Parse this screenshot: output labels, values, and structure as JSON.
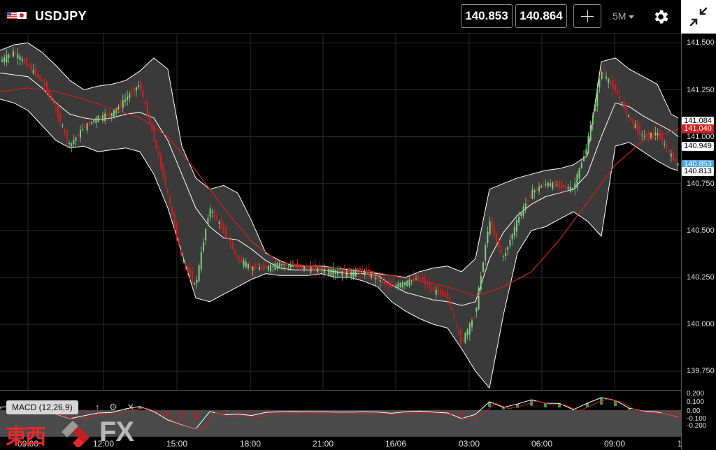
{
  "header": {
    "symbol": "USDJPY",
    "bid": "140.853",
    "ask": "140.864",
    "interval": "5M",
    "icons": [
      "us-flag-icon",
      "japan-flag-icon",
      "crosshair-icon",
      "gear-icon",
      "collapse-icon"
    ]
  },
  "y_axis": {
    "labels": [
      "141.500",
      "141.250",
      "141.000",
      "140.750",
      "140.500",
      "140.250",
      "140.000",
      "139.750"
    ],
    "tags": [
      {
        "text": "141.084",
        "style": "w"
      },
      {
        "text": "141.040",
        "style": "r"
      },
      {
        "text": "140.949",
        "style": "w"
      },
      {
        "text": "140.853",
        "style": "b"
      },
      {
        "text": "140.813",
        "style": "w"
      }
    ]
  },
  "macd": {
    "label": "MACD (12,26,9)",
    "axis_labels": [
      "0.200",
      "0.100",
      "0.00",
      "-0.100",
      "-0.200"
    ],
    "tools": [
      "↑",
      "⚙",
      "✕"
    ]
  },
  "x_axis": {
    "labels": [
      "09:00",
      "12:00",
      "15:00",
      "18:00",
      "21:00",
      "16/06",
      "03:00",
      "06:00",
      "09:00",
      "1"
    ]
  },
  "logo": {
    "kanji": "東西",
    "fx": "FX"
  },
  "colors": {
    "background": "#000000",
    "band_fill": "#3a3a3a",
    "band_line": "#ffffff",
    "ma_line": "#d0211f",
    "bull": "#7fd07f",
    "bear": "#d0211f"
  },
  "chart_data": {
    "type": "line",
    "title": "",
    "ylim": [
      139.65,
      141.55
    ],
    "bollinger": {
      "x": [
        0,
        20,
        40,
        60,
        80,
        100,
        120,
        140,
        160,
        180,
        200,
        220,
        240,
        260,
        280,
        300,
        320,
        340,
        360,
        380,
        400,
        420,
        440,
        460,
        480,
        500,
        520,
        540,
        560,
        580,
        600,
        620,
        640,
        660,
        680,
        700,
        720,
        740,
        760,
        780,
        800,
        820,
        840,
        860,
        880,
        900,
        920,
        940,
        960,
        970
      ],
      "upper": [
        141.46,
        141.49,
        141.5,
        141.45,
        141.38,
        141.3,
        141.25,
        141.27,
        141.28,
        141.3,
        141.35,
        141.42,
        141.36,
        140.95,
        140.78,
        140.72,
        140.74,
        140.7,
        140.55,
        140.38,
        140.34,
        140.31,
        140.31,
        140.31,
        140.3,
        140.29,
        140.28,
        140.27,
        140.26,
        140.25,
        140.28,
        140.3,
        140.31,
        140.28,
        140.35,
        140.72,
        140.75,
        140.78,
        140.8,
        140.82,
        140.83,
        140.85,
        140.9,
        141.4,
        141.42,
        141.36,
        141.32,
        141.28,
        141.12,
        141.1
      ],
      "middle": [
        141.34,
        141.33,
        141.32,
        141.26,
        141.18,
        141.12,
        141.1,
        141.09,
        141.1,
        141.12,
        141.13,
        141.1,
        140.98,
        140.8,
        140.62,
        140.52,
        140.46,
        140.45,
        140.4,
        140.34,
        140.3,
        140.29,
        140.29,
        140.29,
        140.28,
        140.27,
        140.27,
        140.26,
        140.21,
        140.17,
        140.15,
        140.13,
        140.12,
        140.1,
        140.12,
        140.35,
        140.49,
        140.58,
        140.64,
        140.68,
        140.7,
        140.72,
        140.8,
        141.0,
        141.18,
        141.16,
        141.11,
        141.07,
        141.03,
        141.0
      ],
      "lower": [
        141.2,
        141.18,
        141.14,
        141.06,
        140.98,
        140.94,
        140.95,
        140.92,
        140.93,
        140.94,
        140.92,
        140.8,
        140.62,
        140.38,
        140.14,
        140.12,
        140.16,
        140.2,
        140.24,
        140.27,
        140.26,
        140.26,
        140.26,
        140.27,
        140.25,
        140.25,
        140.23,
        140.2,
        140.12,
        140.07,
        140.03,
        140.0,
        139.98,
        139.87,
        139.75,
        139.66,
        140.05,
        140.38,
        140.5,
        140.52,
        140.56,
        140.6,
        140.55,
        140.47,
        140.95,
        140.97,
        140.92,
        140.87,
        140.83,
        140.82
      ]
    },
    "moving_average": {
      "x": [
        0,
        40,
        80,
        120,
        160,
        200,
        240,
        280,
        320,
        360,
        400,
        440,
        480,
        520,
        560,
        600,
        640,
        680,
        720,
        760,
        800,
        840,
        880,
        920,
        970
      ],
      "values": [
        141.24,
        141.26,
        141.24,
        141.2,
        141.15,
        141.1,
        141.0,
        140.82,
        140.62,
        140.44,
        140.33,
        140.31,
        140.3,
        140.29,
        140.26,
        140.23,
        140.2,
        140.15,
        140.2,
        140.28,
        140.45,
        140.65,
        140.85,
        140.98,
        141.04
      ]
    },
    "price": {
      "x": [
        0,
        20,
        40,
        60,
        80,
        100,
        120,
        140,
        160,
        180,
        200,
        220,
        240,
        260,
        280,
        300,
        320,
        340,
        360,
        380,
        400,
        420,
        440,
        460,
        480,
        500,
        520,
        540,
        560,
        580,
        600,
        620,
        640,
        660,
        680,
        700,
        720,
        740,
        760,
        780,
        800,
        820,
        840,
        860,
        880,
        900,
        920,
        940,
        960,
        970
      ],
      "values": [
        141.4,
        141.45,
        141.38,
        141.3,
        141.15,
        140.95,
        141.05,
        141.1,
        141.12,
        141.2,
        141.28,
        141.0,
        140.7,
        140.35,
        140.2,
        140.62,
        140.5,
        140.35,
        140.3,
        140.3,
        140.32,
        140.31,
        140.3,
        140.29,
        140.28,
        140.27,
        140.28,
        140.24,
        140.2,
        140.22,
        140.25,
        140.18,
        140.15,
        139.9,
        140.05,
        140.55,
        140.35,
        140.55,
        140.7,
        140.75,
        140.74,
        140.72,
        140.95,
        141.35,
        141.25,
        141.1,
        141.0,
        141.02,
        140.9,
        140.85
      ]
    }
  }
}
